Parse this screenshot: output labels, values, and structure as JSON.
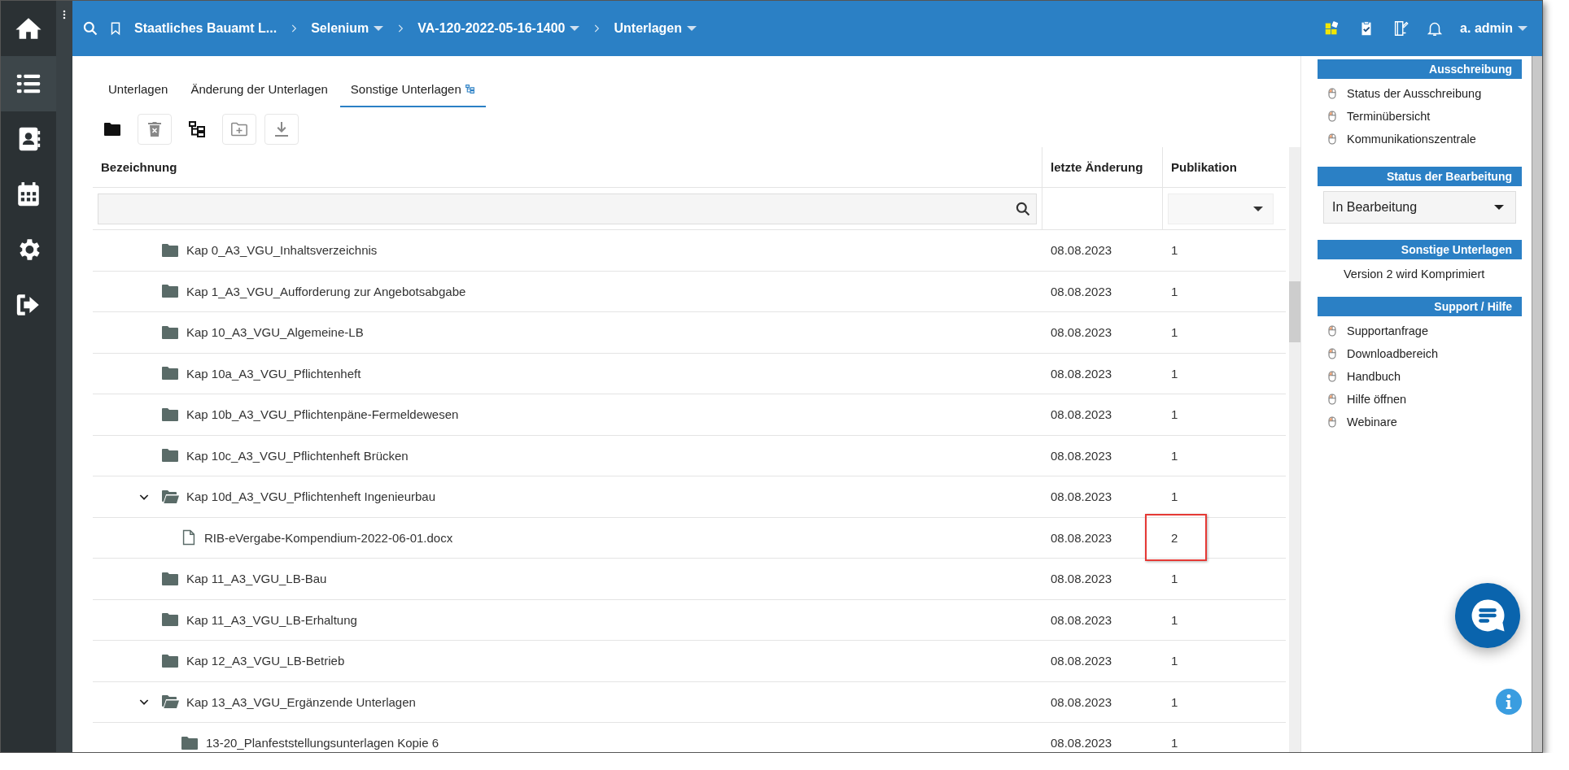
{
  "nav_items": [
    {
      "selected": false
    },
    {
      "selected": true
    },
    {
      "selected": false
    },
    {
      "selected": false
    },
    {
      "selected": false
    },
    {
      "selected": false
    }
  ],
  "topbar": {
    "breadcrumbs": [
      {
        "label": "Staatliches Bauamt L...",
        "dropdown": false
      },
      {
        "label": "Selenium",
        "dropdown": true
      },
      {
        "label": "VA-120-2022-05-16-1400",
        "dropdown": true
      },
      {
        "label": "Unterlagen",
        "dropdown": true
      }
    ],
    "user": {
      "label": "a. admin",
      "dropdown": true
    }
  },
  "tabs": [
    {
      "label": "Unterlagen",
      "selected": false
    },
    {
      "label": "Änderung der Unterlagen",
      "selected": false
    },
    {
      "label": "Sonstige Unterlagen",
      "selected": true
    }
  ],
  "toolbar": [
    {
      "disabled": false
    },
    {
      "disabled": true
    },
    {
      "disabled": false
    },
    {
      "disabled": true
    },
    {
      "disabled": true
    }
  ],
  "table": {
    "columns": [
      "Bezeichnung",
      "letzte Änderung",
      "Publikation"
    ],
    "rows": [
      {
        "kind": "folder",
        "name": "Kap 0_A3_VGU_Inhaltsverzeichnis",
        "date": "08.08.2023",
        "publication": "1",
        "marked": false
      },
      {
        "kind": "folder",
        "name": "Kap 1_A3_VGU_Aufforderung zur Angebotsabgabe",
        "date": "08.08.2023",
        "publication": "1",
        "marked": false
      },
      {
        "kind": "folder",
        "name": "Kap 10_A3_VGU_Algemeine-LB",
        "date": "08.08.2023",
        "publication": "1",
        "marked": false
      },
      {
        "kind": "folder",
        "name": "Kap 10a_A3_VGU_Pflichtenheft",
        "date": "08.08.2023",
        "publication": "1",
        "marked": false
      },
      {
        "kind": "folder",
        "name": "Kap 10b_A3_VGU_Pflichtenpäne-Fermeldewesen",
        "date": "08.08.2023",
        "publication": "1",
        "marked": false
      },
      {
        "kind": "folder",
        "name": "Kap 10c_A3_VGU_Pflichtenheft Brücken",
        "date": "08.08.2023",
        "publication": "1",
        "marked": false
      },
      {
        "kind": "folder",
        "name": "Kap 10d_A3_VGU_Pflichtenheft Ingenieurbau",
        "date": "08.08.2023",
        "publication": "1",
        "marked": false,
        "expanded": true,
        "children": [
          {
            "kind": "file",
            "name": "RIB-eVergabe-Kompendium-2022-06-01.docx",
            "date": "08.08.2023",
            "publication": "2",
            "marked": true
          }
        ]
      },
      {
        "kind": "folder",
        "name": "Kap 11_A3_VGU_LB-Bau",
        "date": "08.08.2023",
        "publication": "1",
        "marked": false
      },
      {
        "kind": "folder",
        "name": "Kap 11_A3_VGU_LB-Erhaltung",
        "date": "08.08.2023",
        "publication": "1",
        "marked": false
      },
      {
        "kind": "folder",
        "name": "Kap 12_A3_VGU_LB-Betrieb",
        "date": "08.08.2023",
        "publication": "1",
        "marked": false
      },
      {
        "kind": "folder",
        "name": "Kap 13_A3_VGU_Ergänzende Unterlagen",
        "date": "08.08.2023",
        "publication": "1",
        "marked": false,
        "expanded": true,
        "children": [
          {
            "kind": "folder",
            "name": "13-20_Planfeststellungsunterlagen Kopie 6",
            "date": "08.08.2023",
            "publication": "1",
            "marked": false
          }
        ]
      }
    ]
  },
  "side_panel": {
    "sections": [
      {
        "kind": "links",
        "title": "Ausschreibung",
        "items": [
          "Status der Ausschreibung",
          "Terminübersicht",
          "Kommunikationszentrale"
        ]
      },
      {
        "kind": "select",
        "title": "Status der Bearbeitung",
        "value": "In Bearbeitung"
      },
      {
        "kind": "text",
        "title": "Sonstige Unterlagen",
        "text": "Version 2 wird Komprimiert"
      },
      {
        "kind": "links",
        "title": "Support / Hilfe",
        "items": [
          "Supportanfrage",
          "Downloadbereich",
          "Handbuch",
          "Hilfe öffnen",
          "Webinare"
        ]
      }
    ]
  }
}
